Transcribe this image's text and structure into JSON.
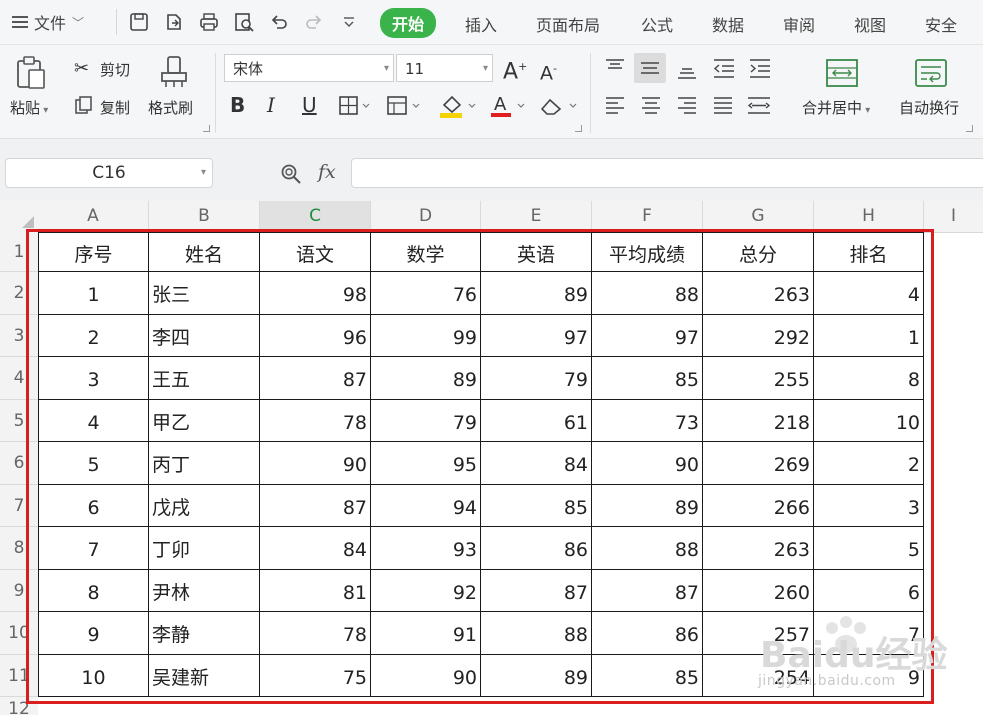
{
  "menubar": {
    "file_label": "文件",
    "tabs": [
      "开始",
      "插入",
      "页面布局",
      "公式",
      "数据",
      "审阅",
      "视图",
      "安全"
    ],
    "active_tab": "开始"
  },
  "ribbon": {
    "paste_label": "粘贴",
    "cut_label": "剪切",
    "copy_label": "复制",
    "format_painter_label": "格式刷",
    "font_name": "宋体",
    "font_size": "11",
    "merge_center_label": "合并居中",
    "wrap_text_label": "自动换行"
  },
  "formula_bar": {
    "cell_ref": "C16",
    "fx_label": "fx",
    "formula": ""
  },
  "sheet": {
    "columns": [
      "A",
      "B",
      "C",
      "D",
      "E",
      "F",
      "G",
      "H",
      "I"
    ],
    "selected_column": "C",
    "row_numbers": [
      "1",
      "2",
      "3",
      "4",
      "5",
      "6",
      "7",
      "8",
      "9",
      "10",
      "11",
      "12"
    ],
    "headers": [
      "序号",
      "姓名",
      "语文",
      "数学",
      "英语",
      "平均成绩",
      "总分",
      "排名"
    ],
    "rows": [
      [
        "1",
        "张三",
        "98",
        "76",
        "89",
        "88",
        "263",
        "4"
      ],
      [
        "2",
        "李四",
        "96",
        "99",
        "97",
        "97",
        "292",
        "1"
      ],
      [
        "3",
        "王五",
        "87",
        "89",
        "79",
        "85",
        "255",
        "8"
      ],
      [
        "4",
        "甲乙",
        "78",
        "79",
        "61",
        "73",
        "218",
        "10"
      ],
      [
        "5",
        "丙丁",
        "90",
        "95",
        "84",
        "90",
        "269",
        "2"
      ],
      [
        "6",
        "戊戌",
        "87",
        "94",
        "85",
        "89",
        "266",
        "3"
      ],
      [
        "7",
        "丁卯",
        "84",
        "93",
        "86",
        "88",
        "263",
        "5"
      ],
      [
        "8",
        "尹林",
        "81",
        "92",
        "87",
        "87",
        "260",
        "6"
      ],
      [
        "9",
        "李静",
        "78",
        "91",
        "88",
        "86",
        "257",
        "7"
      ],
      [
        "10",
        "吴建新",
        "75",
        "90",
        "89",
        "85",
        "254",
        "9"
      ]
    ]
  },
  "watermark": {
    "brand": "Baidu经验",
    "url": "jingyan.baidu.com"
  },
  "colors": {
    "active_tab": "#3ab34a",
    "highlight_border": "#d81e1e",
    "selected_column_text": "#1e8e3e"
  }
}
